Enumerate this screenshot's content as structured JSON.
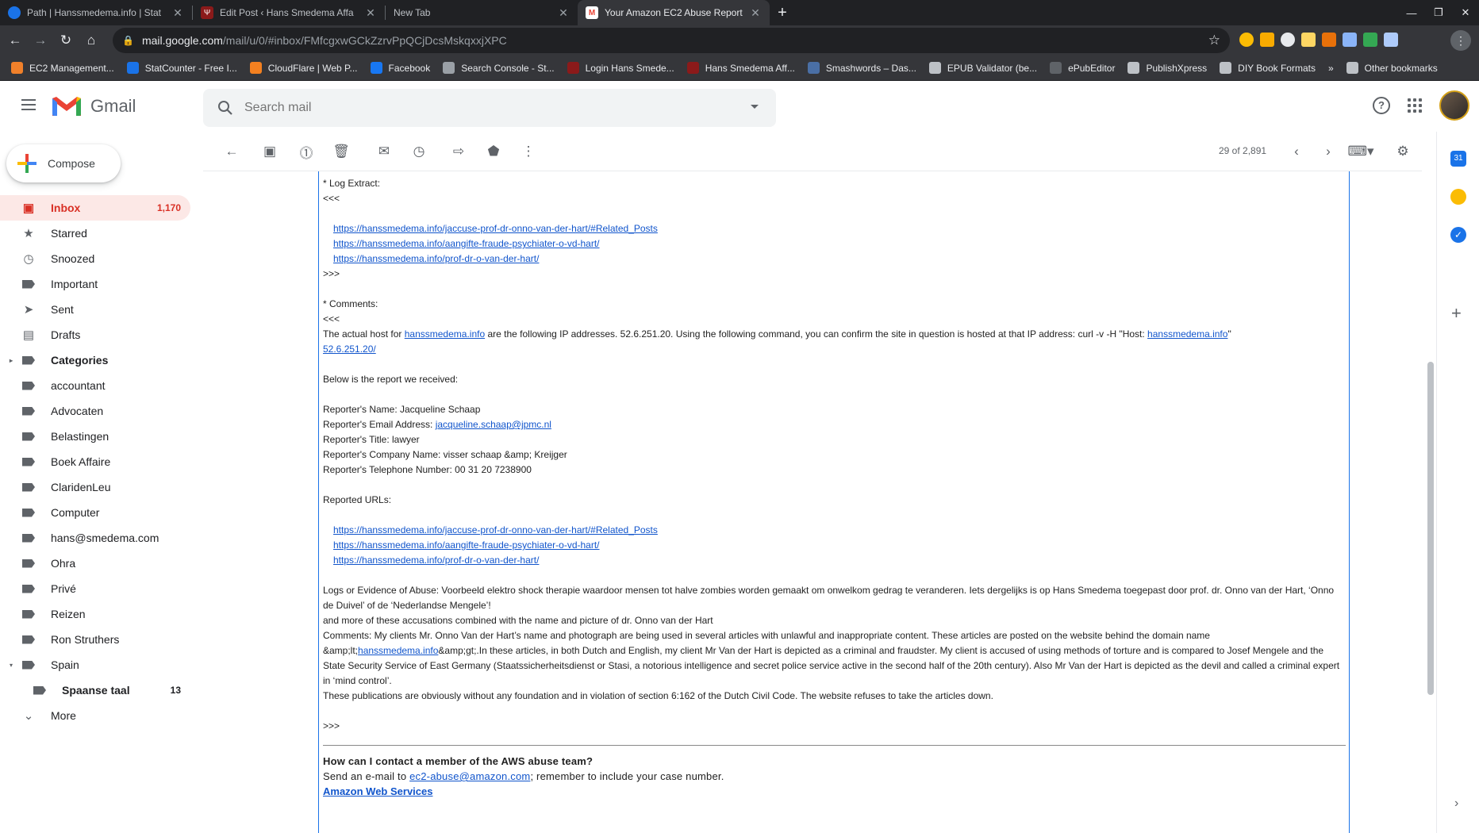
{
  "browser": {
    "tabs": [
      {
        "title": "Path | Hanssmedema.info | Stat",
        "favicon": "statcounter-icon"
      },
      {
        "title": "Edit Post ‹ Hans Smedema Affa",
        "favicon": "hans-smedema-icon"
      },
      {
        "title": "New Tab",
        "favicon": ""
      },
      {
        "title": "Your Amazon EC2 Abuse Report",
        "favicon": "gmail-icon"
      }
    ],
    "url_host": "mail.google.com",
    "url_path": "/mail/u/0/#inbox/FMfcgxwGCkZzrvPpQCjDcsMskqxxjXPC",
    "bookmarks": [
      {
        "label": "EC2 Management...",
        "color": "#f0802a"
      },
      {
        "label": "StatCounter - Free I...",
        "color": "#1a73e8"
      },
      {
        "label": "CloudFlare | Web P...",
        "color": "#f38020"
      },
      {
        "label": "Facebook",
        "color": "#1877f2"
      },
      {
        "label": "Search Console - St...",
        "color": "#9aa0a6"
      },
      {
        "label": "Login Hans Smede...",
        "color": "#8b1a1a"
      },
      {
        "label": "Hans Smedema Aff...",
        "color": "#8b1a1a"
      },
      {
        "label": "Smashwords – Das...",
        "color": "#4a6fa5"
      },
      {
        "label": "EPUB Validator (be...",
        "color": "#bdc1c6"
      },
      {
        "label": "ePubEditor",
        "color": "#5f6368"
      },
      {
        "label": "PublishXpress",
        "color": "#bdc1c6"
      },
      {
        "label": "DIY Book Formats",
        "color": "#bdc1c6"
      }
    ],
    "more_bookmarks": "»",
    "other_bookmarks": "Other bookmarks"
  },
  "gmail": {
    "brand": "Gmail",
    "search_placeholder": "Search mail",
    "compose": "Compose",
    "nav": [
      {
        "label": "Inbox",
        "icon": "inbox-icon",
        "count": "1,170",
        "selected": true
      },
      {
        "label": "Starred",
        "icon": "star-icon",
        "count": ""
      },
      {
        "label": "Snoozed",
        "icon": "clock-icon",
        "count": ""
      },
      {
        "label": "Important",
        "icon": "important-icon",
        "count": ""
      },
      {
        "label": "Sent",
        "icon": "send-icon",
        "count": ""
      },
      {
        "label": "Drafts",
        "icon": "draft-icon",
        "count": ""
      },
      {
        "label": "Categories",
        "icon": "label-icon",
        "count": "",
        "bold": true,
        "expand": "▸"
      },
      {
        "label": "accountant",
        "icon": "label-icon",
        "count": ""
      },
      {
        "label": "Advocaten",
        "icon": "label-icon",
        "count": ""
      },
      {
        "label": "Belastingen",
        "icon": "label-icon",
        "count": ""
      },
      {
        "label": "Boek Affaire",
        "icon": "label-icon",
        "count": ""
      },
      {
        "label": "ClaridenLeu",
        "icon": "label-icon",
        "count": ""
      },
      {
        "label": "Computer",
        "icon": "label-icon",
        "count": ""
      },
      {
        "label": "hans@smedema.com",
        "icon": "label-icon",
        "count": ""
      },
      {
        "label": "Ohra",
        "icon": "label-icon",
        "count": ""
      },
      {
        "label": "Privé",
        "icon": "label-icon",
        "count": ""
      },
      {
        "label": "Reizen",
        "icon": "label-icon",
        "count": ""
      },
      {
        "label": "Ron Struthers",
        "icon": "label-icon",
        "count": ""
      },
      {
        "label": "Spain",
        "icon": "label-icon",
        "count": "",
        "expand": "▾"
      },
      {
        "label": "Spaanse taal",
        "icon": "label-icon",
        "count": "13",
        "bold": true,
        "sub": true
      },
      {
        "label": "More",
        "icon": "chevron-down-icon",
        "count": ""
      }
    ],
    "page_count": "29 of 2,891"
  },
  "email": {
    "log_extract_label": "* Log Extract:",
    "open": "<<<",
    "close": ">>>",
    "urls": [
      "https://hanssmedema.info/jaccuse-prof-dr-onno-van-der-hart/#Related_Posts",
      "https://hanssmedema.info/aangifte-fraude-psychiater-o-vd-hart/",
      "https://hanssmedema.info/prof-dr-o-van-der-hart/"
    ],
    "comments_label": "* Comments:",
    "host_text_1": "The actual host for ",
    "host_link": "hanssmedema.info",
    "host_text_2": " are the following IP addresses. 52.6.251.20. Using the following command, you can confirm the site in question is hosted at that IP address: curl -v -H \"Host: ",
    "host_link_2": "hanssmedema.info",
    "host_text_3": "\"",
    "ip_link": "52.6.251.20/",
    "report_intro": "Below is the report we received:",
    "reporter_name": "Reporter's Name: Jacqueline Schaap",
    "reporter_email_label": "Reporter's Email Address: ",
    "reporter_email": "jacqueline.schaap@jpmc.nl",
    "reporter_title": "Reporter's Title: lawyer",
    "reporter_company": "Reporter's Company Name: visser schaap &amp; Kreijger",
    "reporter_phone": "Reporter's Telephone Number: 00 31 20 7238900",
    "reported_urls_label": "Reported URLs:",
    "evidence_1": "Logs or Evidence of Abuse: Voorbeeld elektro shock therapie waardoor mensen tot halve zombies worden gemaakt om onwelkom gedrag te veranderen. Iets dergelijks is op Hans Smedema toegepast door prof. dr. Onno van der Hart, ‘Onno de Duivel’ of de ‘Nederlandse Mengele’!",
    "evidence_2": "and more of these accusations combined with the name and picture of dr. Onno van der Hart",
    "comments_1a": "Comments: My clients Mr. Onno Van der Hart’s name and photograph are being used in several articles with unlawful and inappropriate content. These articles are posted on the website behind the domain name &amp;lt;",
    "comments_link": "hanssmedema.info",
    "comments_1b": "&amp;gt;.In these articles, in both Dutch and English, my client Mr Van der Hart is depicted as a criminal and fraudster. My client is accused of using methods of torture and is compared to Josef Mengele and the State Security Service of East Germany (Staatssicherheitsdienst or Stasi, a notorious intelligence and secret police service active in the second half of the 20th century). Also Mr Van der Hart is depicted as the devil and called a criminal expert in ‘mind control’.",
    "comments_2": "These publications are obviously without any foundation and in violation of section 6:162 of the Dutch Civil Code. The website refuses to take the articles down.",
    "contact_q": "How can I contact a member of the AWS abuse team?",
    "contact_a1": "Send an e-mail to ",
    "contact_email": "ec2-abuse@amazon.com",
    "contact_a2": "; remember to include your case number.",
    "aws_link": "Amazon Web Services"
  }
}
